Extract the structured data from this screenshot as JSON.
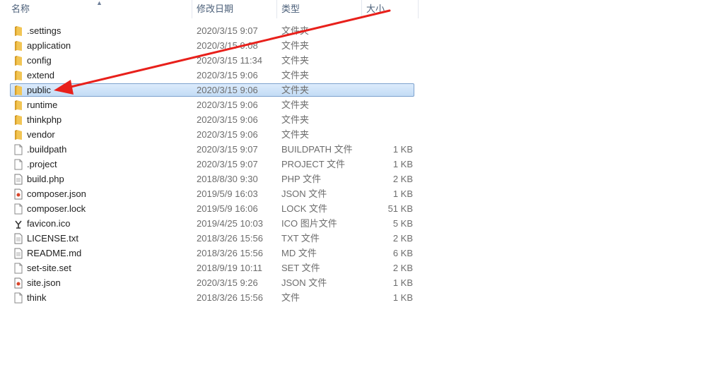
{
  "columns": {
    "name": "名称",
    "date": "修改日期",
    "type": "类型",
    "size": "大小"
  },
  "colors": {
    "selection": "#cce8ff",
    "annotation_arrow": "#e8201b",
    "folder": "#e8b43a"
  },
  "files": [
    {
      "name": ".settings",
      "date": "2020/3/15 9:07",
      "type": "文件夹",
      "size": "",
      "icon": "folder-icon"
    },
    {
      "name": "application",
      "date": "2020/3/15 9:08",
      "type": "文件夹",
      "size": "",
      "icon": "folder-icon"
    },
    {
      "name": "config",
      "date": "2020/3/15 11:34",
      "type": "文件夹",
      "size": "",
      "icon": "folder-icon"
    },
    {
      "name": "extend",
      "date": "2020/3/15 9:06",
      "type": "文件夹",
      "size": "",
      "icon": "folder-icon"
    },
    {
      "name": "public",
      "date": "2020/3/15 9:06",
      "type": "文件夹",
      "size": "",
      "icon": "folder-icon",
      "selected": true
    },
    {
      "name": "runtime",
      "date": "2020/3/15 9:06",
      "type": "文件夹",
      "size": "",
      "icon": "folder-icon"
    },
    {
      "name": "thinkphp",
      "date": "2020/3/15 9:06",
      "type": "文件夹",
      "size": "",
      "icon": "folder-icon"
    },
    {
      "name": "vendor",
      "date": "2020/3/15 9:06",
      "type": "文件夹",
      "size": "",
      "icon": "folder-icon"
    },
    {
      "name": ".buildpath",
      "date": "2020/3/15 9:07",
      "type": "BUILDPATH 文件",
      "size": "1 KB",
      "icon": "file-icon"
    },
    {
      "name": ".project",
      "date": "2020/3/15 9:07",
      "type": "PROJECT 文件",
      "size": "1 KB",
      "icon": "file-icon"
    },
    {
      "name": "build.php",
      "date": "2018/8/30 9:30",
      "type": "PHP 文件",
      "size": "2 KB",
      "icon": "text-file-icon"
    },
    {
      "name": "composer.json",
      "date": "2019/5/9 16:03",
      "type": "JSON 文件",
      "size": "1 KB",
      "icon": "json-file-icon"
    },
    {
      "name": "composer.lock",
      "date": "2019/5/9 16:06",
      "type": "LOCK 文件",
      "size": "51 KB",
      "icon": "file-icon"
    },
    {
      "name": "favicon.ico",
      "date": "2019/4/25 10:03",
      "type": "ICO 图片文件",
      "size": "5 KB",
      "icon": "ico-file-icon"
    },
    {
      "name": "LICENSE.txt",
      "date": "2018/3/26 15:56",
      "type": "TXT 文件",
      "size": "2 KB",
      "icon": "text-file-icon"
    },
    {
      "name": "README.md",
      "date": "2018/3/26 15:56",
      "type": "MD 文件",
      "size": "6 KB",
      "icon": "text-file-icon"
    },
    {
      "name": "set-site.set",
      "date": "2018/9/19 10:11",
      "type": "SET 文件",
      "size": "2 KB",
      "icon": "file-icon"
    },
    {
      "name": "site.json",
      "date": "2020/3/15 9:26",
      "type": "JSON 文件",
      "size": "1 KB",
      "icon": "json-file-icon"
    },
    {
      "name": "think",
      "date": "2018/3/26 15:56",
      "type": "文件",
      "size": "1 KB",
      "icon": "file-icon"
    }
  ]
}
